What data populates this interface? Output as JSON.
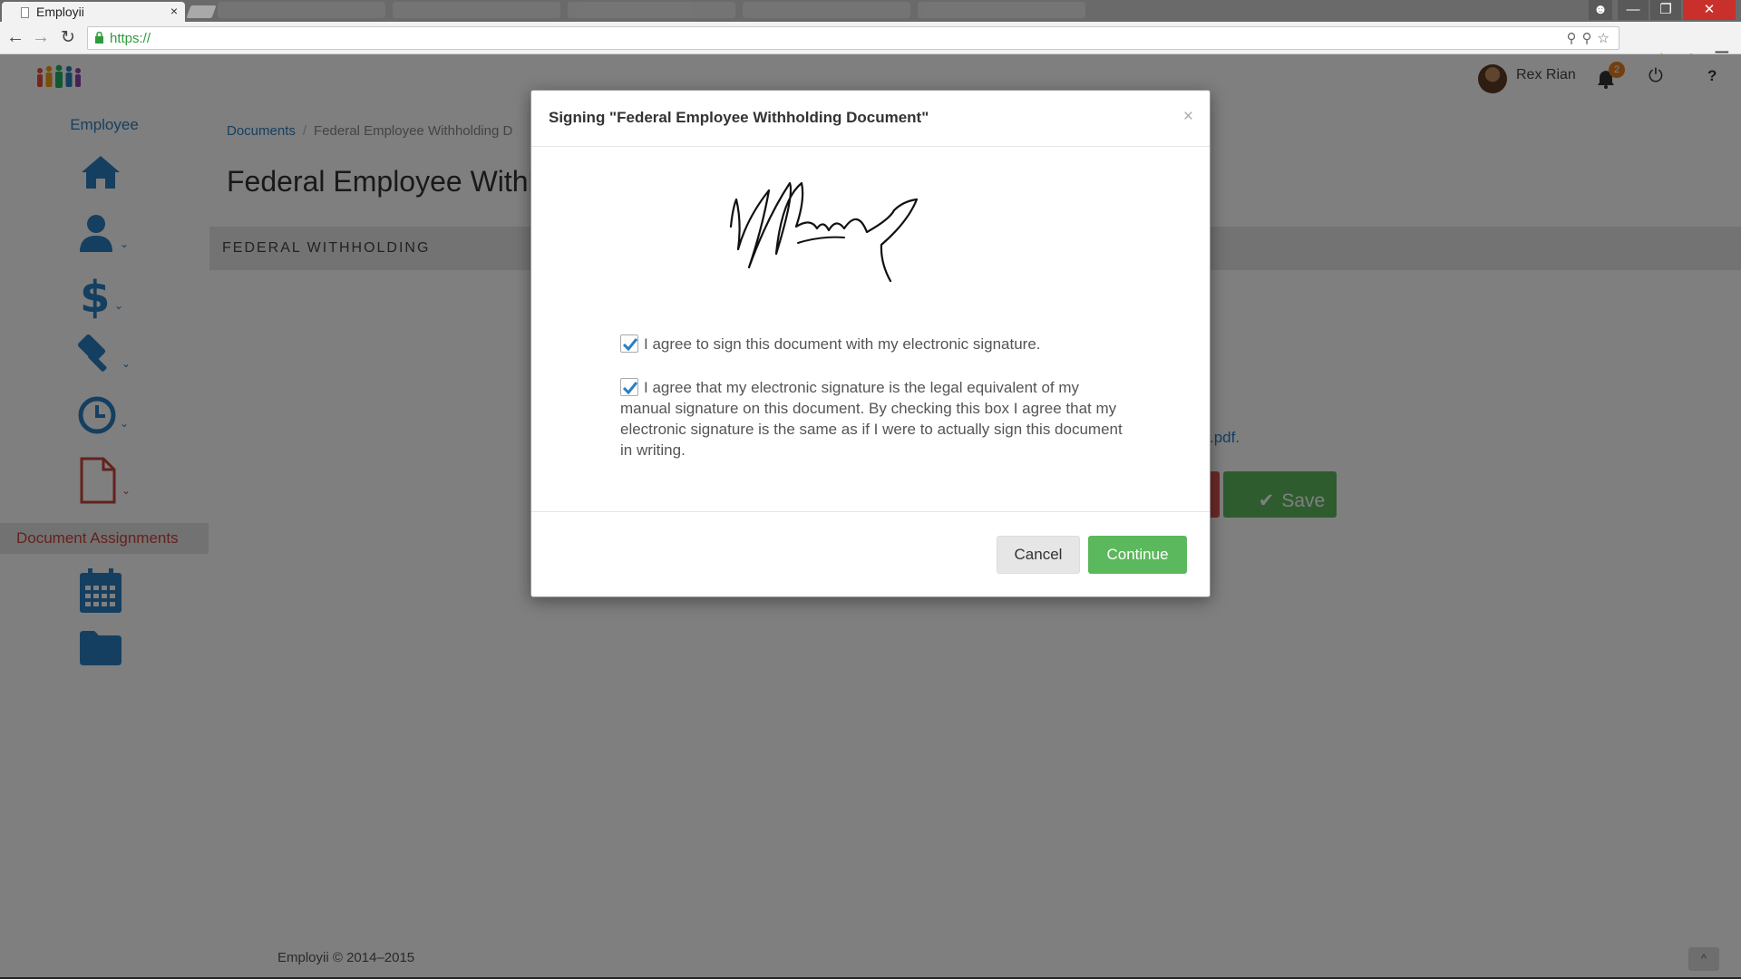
{
  "browser": {
    "tab_title": "Employii",
    "tab_close": "×",
    "url": "https://",
    "menu_icon": "hamburger-menu-icon"
  },
  "app": {
    "user_name": "Rex Rian",
    "notification_count": "2",
    "help_label": "?",
    "sidebar": {
      "heading": "Employee",
      "active_item": "Document Assignments",
      "icons": [
        "home-icon",
        "user-icon",
        "dollar-icon",
        "gavel-icon",
        "clock-icon",
        "document-icon",
        "calendar-icon",
        "folder-icon"
      ]
    },
    "breadcrumb": {
      "link": "Documents",
      "separator": "/",
      "current": "Federal Employee Withholding D"
    },
    "page_title": "Federal Employee Withho",
    "section_title": "FEDERAL WITHHOLDING",
    "pdf_link": ".pdf.",
    "save_label": "Save",
    "footer": "Employii © 2014–2015",
    "scroll_top_label": "^"
  },
  "modal": {
    "title": "Signing \"Federal Employee Withholding Document\"",
    "close_label": "×",
    "agree_1": "I agree to sign this document with my electronic signature.",
    "agree_2": "I agree that my electronic signature is the legal equivalent of my manual signature on this document. By checking this box I agree that my electronic signature is the same as if I were to actually sign this document in writing.",
    "agree_1_checked": true,
    "agree_2_checked": true,
    "cancel_label": "Cancel",
    "continue_label": "Continue"
  },
  "colors": {
    "primary_link": "#2a7fc1",
    "success": "#5cb85c",
    "danger": "#d9534f",
    "active_nav": "#c9443a",
    "badge": "#e67e22"
  }
}
